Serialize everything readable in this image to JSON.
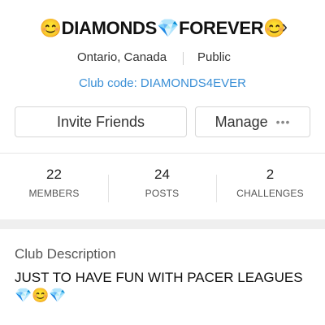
{
  "club": {
    "name": "😊DIAMONDS💎FOREVER😊",
    "location": "Ontario, Canada",
    "visibility": "Public",
    "code_text": "Club code: DIAMONDS4EVER"
  },
  "actions": {
    "invite_label": "Invite Friends",
    "manage_label": "Manage",
    "manage_more_glyph": "•••"
  },
  "stats": [
    {
      "value": "22",
      "label": "MEMBERS"
    },
    {
      "value": "24",
      "label": "POSTS"
    },
    {
      "value": "2",
      "label": "CHALLENGES"
    }
  ],
  "description": {
    "title": "Club Description",
    "body": "JUST TO HAVE FUN WITH  PACER LEAGUES\n💎😊💎"
  },
  "colors": {
    "accent_link": "#3a8fd6",
    "divider": "#e6e6e6",
    "band": "#efefef"
  },
  "icons": {
    "header_chevron": "chevron-right-icon",
    "manage_more": "more-dots-icon"
  }
}
